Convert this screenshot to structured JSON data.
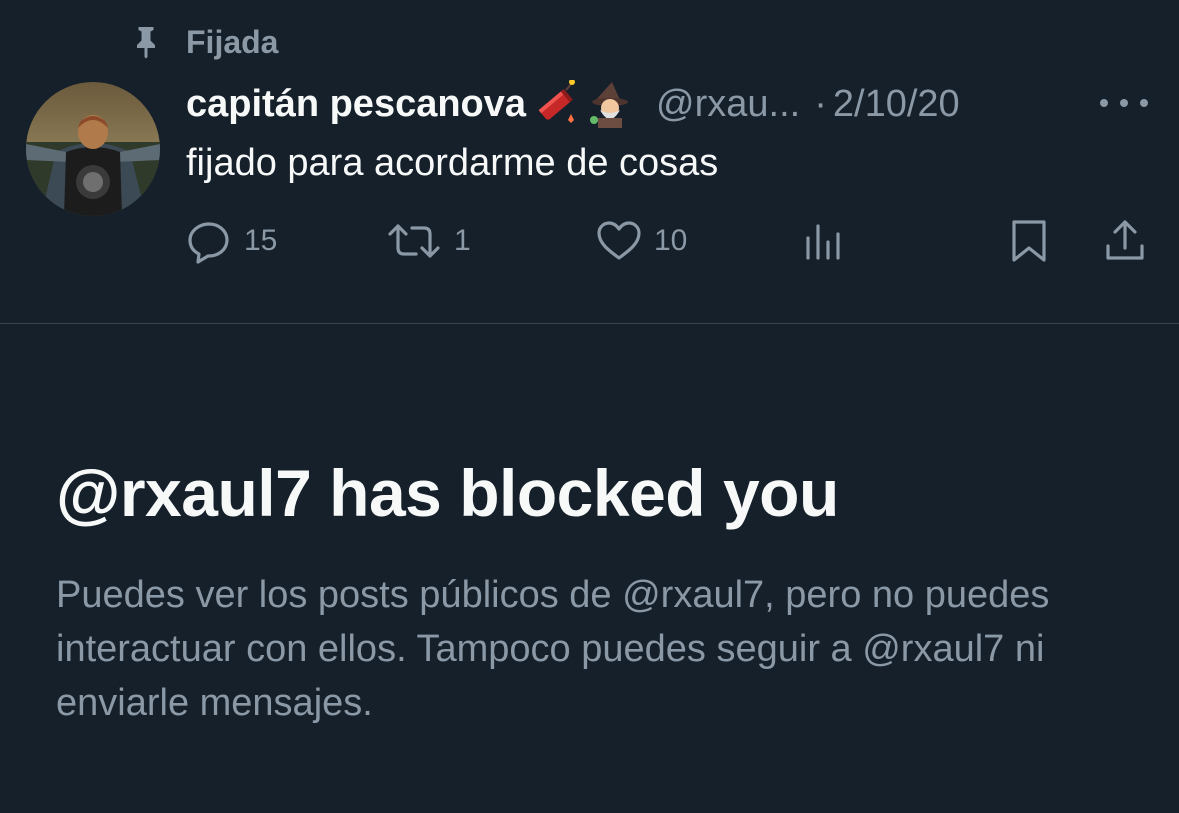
{
  "pinned": {
    "label": "Fijada"
  },
  "tweet": {
    "author_name": "capitán pescanova",
    "author_emojis": [
      "firecracker-emoji",
      "mage-emoji"
    ],
    "handle": "@rxau...",
    "separator": "·",
    "date": "2/10/20",
    "text": "fijado para acordarme de cosas",
    "replies": "15",
    "retweets": "1",
    "likes": "10"
  },
  "blocked": {
    "title": "@rxaul7 has blocked you",
    "description": "Puedes ver los posts públicos de @rxaul7, pero no puedes interactuar con ellos. Tampoco puedes seguir a @rxaul7 ni enviarle mensajes."
  },
  "colors": {
    "background": "#15202b",
    "primary_text": "#f7f9f9",
    "secondary_text": "#8b98a5",
    "divider": "#38444d"
  }
}
